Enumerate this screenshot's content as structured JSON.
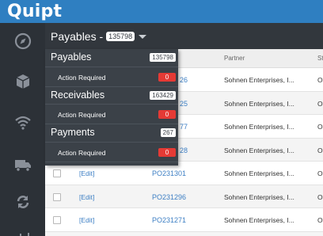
{
  "app": {
    "logo": "Quipt"
  },
  "header": {
    "title": "Payables -",
    "count": "135798"
  },
  "sidebar": {
    "items": [
      {
        "icon": "compass-icon"
      },
      {
        "icon": "box-icon"
      },
      {
        "icon": "wifi-icon"
      },
      {
        "icon": "truck-icon"
      },
      {
        "icon": "sync-icon"
      },
      {
        "icon": "chart-icon"
      }
    ]
  },
  "dropdown": {
    "groups": [
      {
        "label": "Payables",
        "count": "135798",
        "sub_label": "Action Required",
        "sub_count": "0"
      },
      {
        "label": "Receivables",
        "count": "163429",
        "sub_label": "Action Required",
        "sub_count": "0"
      },
      {
        "label": "Payments",
        "count": "267",
        "sub_label": "Action Required",
        "sub_count": "0"
      }
    ]
  },
  "table": {
    "columns": {
      "partner": "Partner",
      "status": "St"
    },
    "rows": [
      {
        "edit": "",
        "po": "26",
        "partner": "Sohnen Enterprises, I...",
        "status": "O"
      },
      {
        "edit": "",
        "po": "25",
        "partner": "Sohnen Enterprises, I...",
        "status": "O"
      },
      {
        "edit": "",
        "po": "77",
        "partner": "Sohnen Enterprises, I...",
        "status": "O"
      },
      {
        "edit": "",
        "po": "28",
        "partner": "Sohnen Enterprises, I...",
        "status": "O"
      },
      {
        "edit": "[Edit]",
        "po": "PO231301",
        "partner": "Sohnen Enterprises, I...",
        "status": "O"
      },
      {
        "edit": "[Edit]",
        "po": "PO231296",
        "partner": "Sohnen Enterprises, I...",
        "status": "O"
      },
      {
        "edit": "[Edit]",
        "po": "PO231271",
        "partner": "Sohnen Enterprises, I...",
        "status": "O"
      }
    ]
  }
}
